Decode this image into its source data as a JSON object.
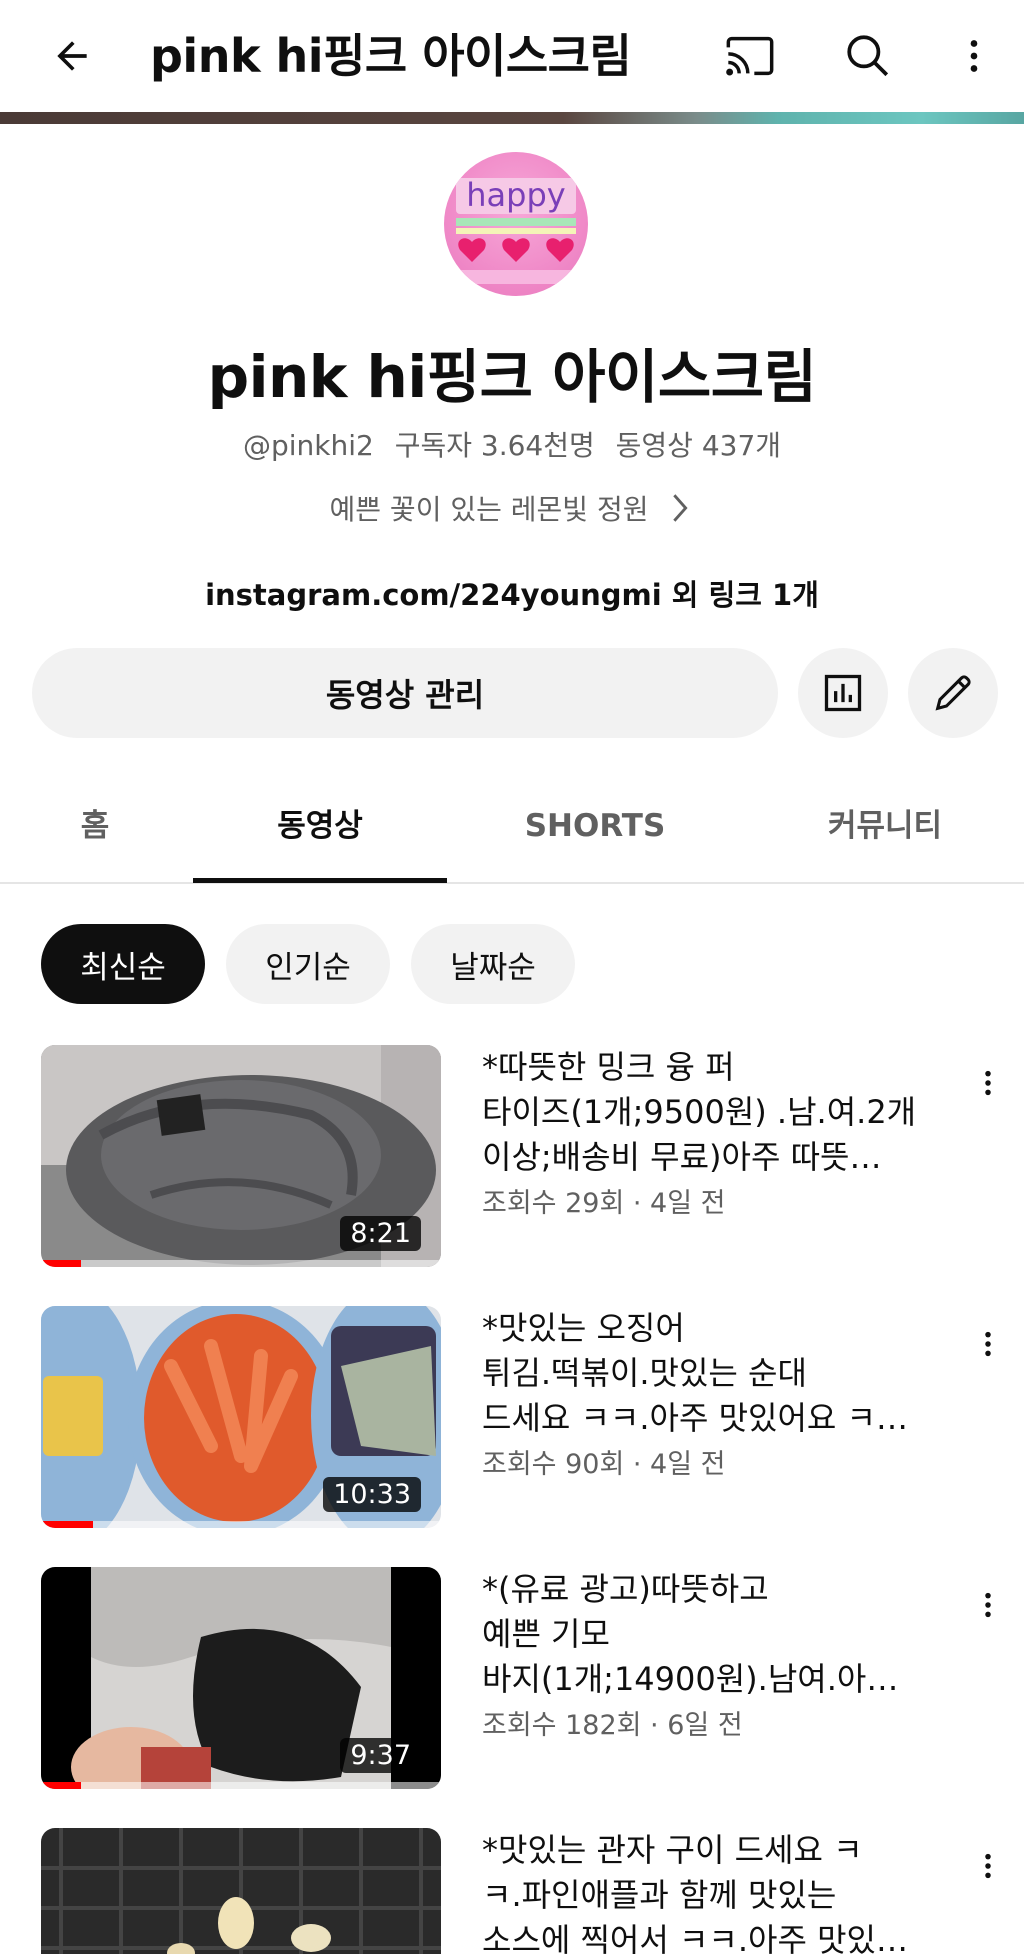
{
  "appbar": {
    "title": "pink hi핑크 아이스크림",
    "back_icon": "back-arrow-icon",
    "cast_icon": "cast-icon",
    "search_icon": "search-icon",
    "more_icon": "more-vert-icon"
  },
  "channel": {
    "avatar_text": "happy",
    "name": "pink hi핑크 아이스크림",
    "handle": "@pinkhi2",
    "subscribers": "구독자 3.64천명",
    "videos_count": "동영상 437개",
    "description": "예쁜 꽃이 있는 레몬빛 정원",
    "links": "instagram.com/224youngmi 외 링크 1개"
  },
  "actions": {
    "manage_label": "동영상 관리",
    "analytics_icon": "analytics-icon",
    "edit_icon": "pencil-icon"
  },
  "tabs": [
    {
      "label": "홈",
      "active": false
    },
    {
      "label": "동영상",
      "active": true
    },
    {
      "label": "SHORTS",
      "active": false
    },
    {
      "label": "커뮤니티",
      "active": false
    }
  ],
  "chips": [
    {
      "label": "최신순",
      "active": true
    },
    {
      "label": "인기순",
      "active": false
    },
    {
      "label": "날짜순",
      "active": false
    }
  ],
  "videos": [
    {
      "title_lines": [
        "*따뜻한 밍크 융 퍼",
        "타이즈(1개;9500원) .남.여.2개",
        "이상;배송비 무료)아주 따뜻…"
      ],
      "meta": "조회수 29회 · 4일 전",
      "duration": "8:21",
      "progress": 0.1
    },
    {
      "title_lines": [
        "*맛있는 오징어",
        "튀김.떡볶이.맛있는 순대",
        "드세요 ㅋㅋ.아주 맛있어요 ㅋ…"
      ],
      "meta": "조회수 90회 · 4일 전",
      "duration": "10:33",
      "progress": 0.13
    },
    {
      "title_lines": [
        "*(유료 광고)따뜻하고",
        "예쁜 기모",
        "바지(1개;14900원).남여.아…"
      ],
      "meta": "조회수 182회 · 6일 전",
      "duration": "9:37",
      "progress": 0.1
    },
    {
      "title_lines": [
        "*맛있는 관자 구이 드세요 ㅋ",
        "ㅋ.파인애플과 함께 맛있는",
        "소스에 찍어서 ㅋㅋ.아주 맛있…"
      ],
      "meta": "",
      "duration": "",
      "progress": 0
    }
  ]
}
